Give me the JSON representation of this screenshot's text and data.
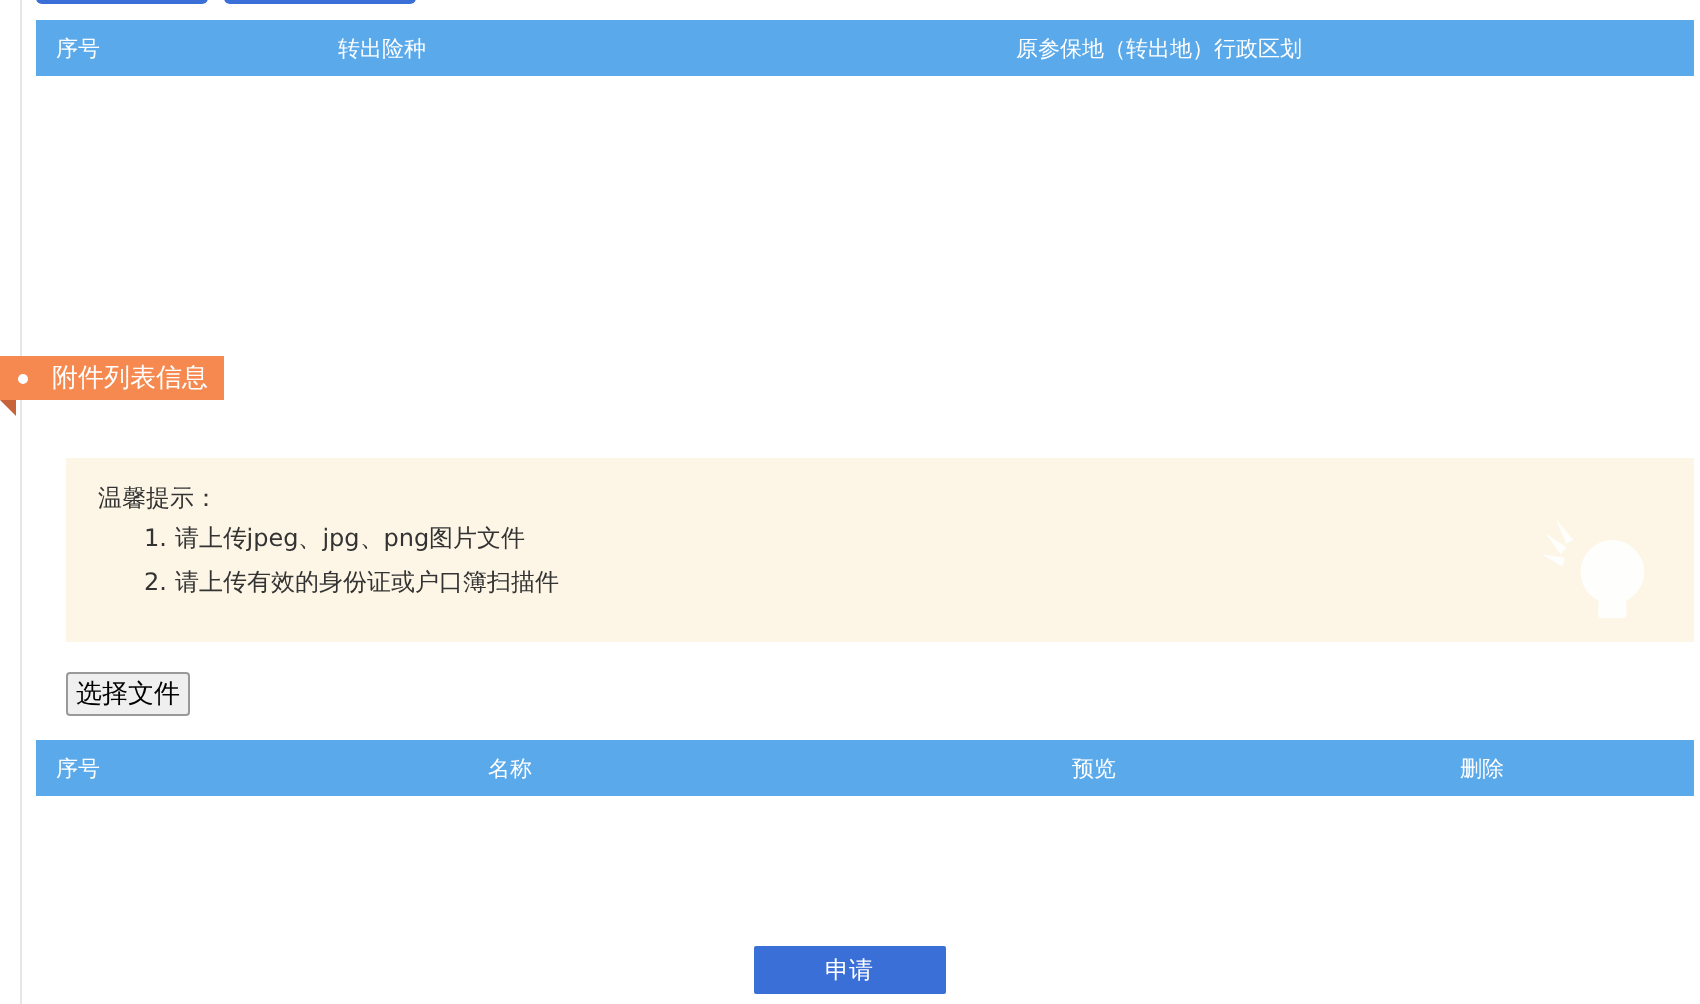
{
  "transfer_table": {
    "columns": [
      "序号",
      "转出险种",
      "原参保地（转出地）行政区划"
    ]
  },
  "section": {
    "title": "附件列表信息"
  },
  "tips": {
    "title": "温馨提示：",
    "items": [
      "1. 请上传jpeg、jpg、png图片文件",
      "2. 请上传有效的身份证或户口簿扫描件"
    ]
  },
  "file_button": "选择文件",
  "attachment_table": {
    "columns": [
      "序号",
      "名称",
      "预览",
      "删除"
    ]
  },
  "submit_button": "申请"
}
